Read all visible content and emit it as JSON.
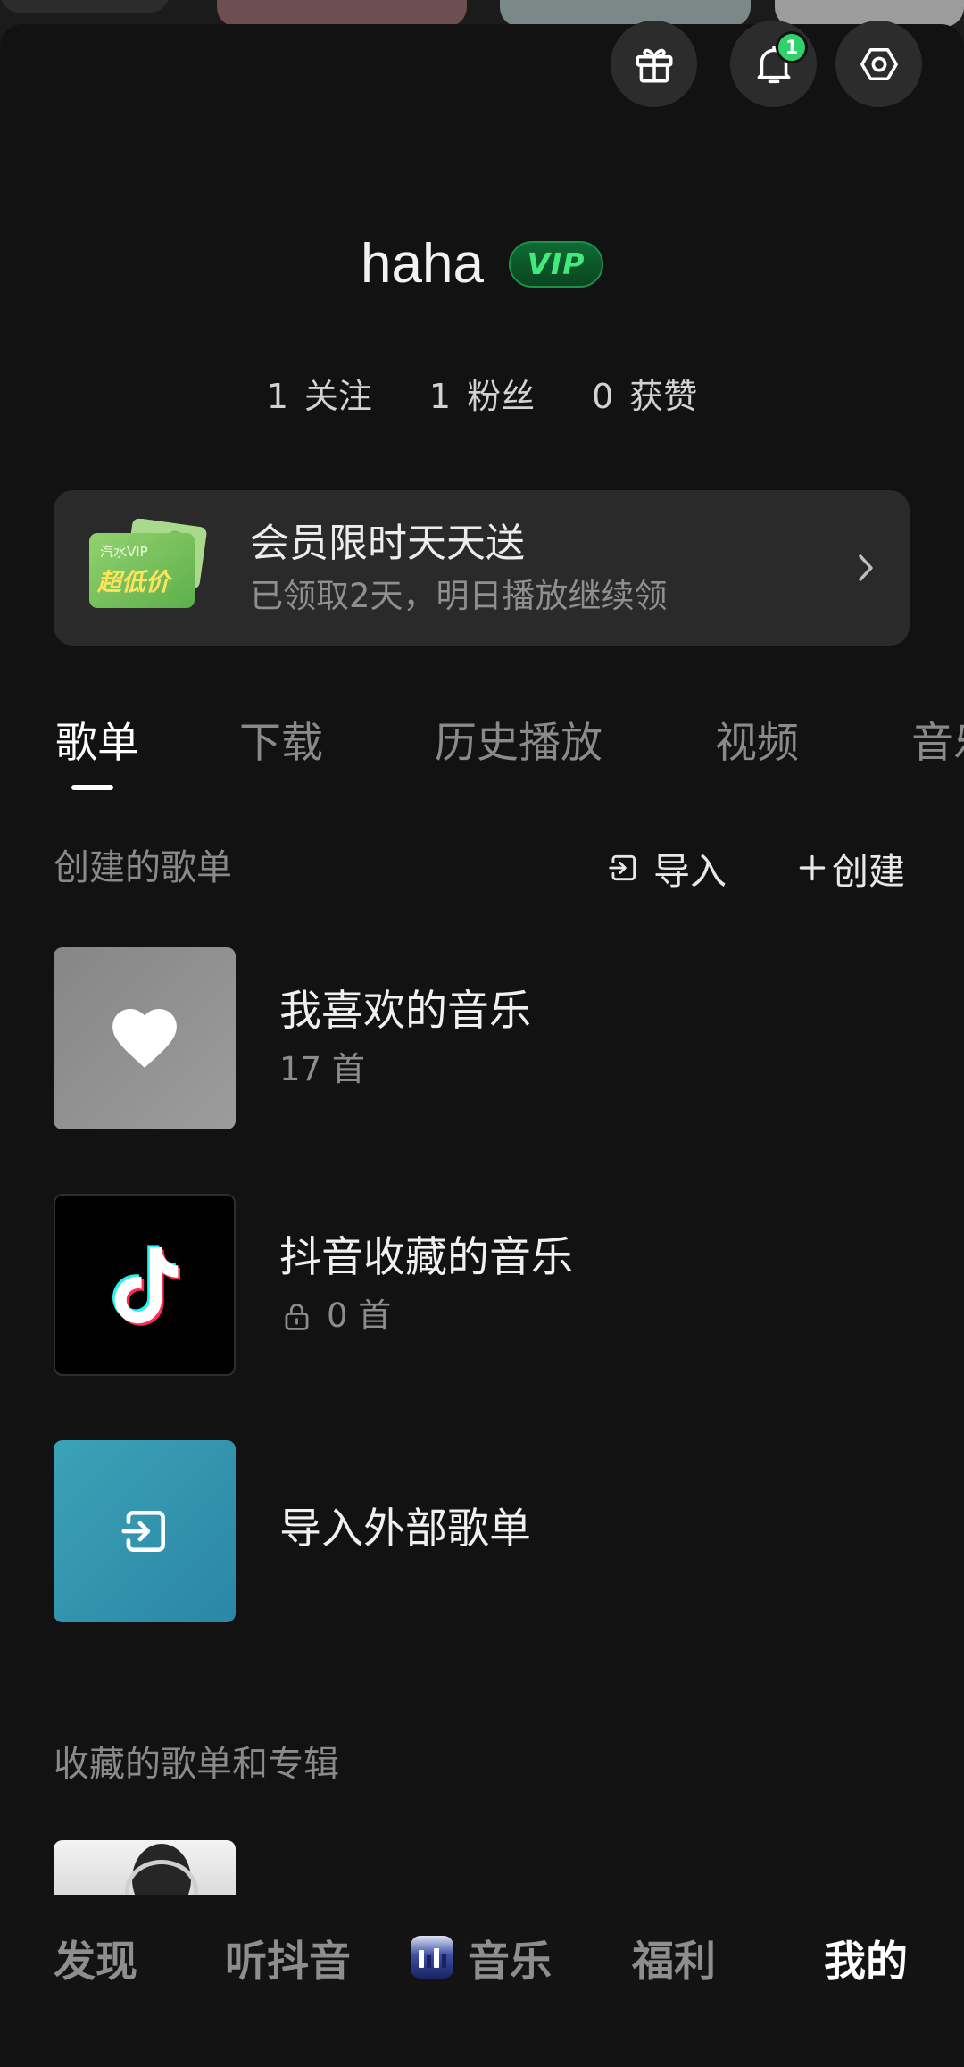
{
  "header": {
    "gift_icon": "gift-icon",
    "notification_icon": "bell-icon",
    "notification_count": "1",
    "settings_icon": "settings-icon"
  },
  "profile": {
    "username": "haha",
    "vip_badge": "VIP",
    "stats": [
      {
        "count": "1",
        "label": "关注"
      },
      {
        "count": "1",
        "label": "粉丝"
      },
      {
        "count": "0",
        "label": "获赞"
      }
    ]
  },
  "promo": {
    "ticket_brand": "汽水VIP",
    "ticket_text": "超低价",
    "title": "会员限时天天送",
    "subtitle": "已领取2天，明日播放继续领",
    "arrow_icon": "chevron-right-icon"
  },
  "tabs": [
    {
      "label": "歌单",
      "active": true
    },
    {
      "label": "下载",
      "active": false
    },
    {
      "label": "历史播放",
      "active": false
    },
    {
      "label": "视频",
      "active": false
    },
    {
      "label": "音乐",
      "active": false
    }
  ],
  "created_playlists": {
    "title": "创建的歌单",
    "import_label": "导入",
    "import_icon": "import-icon",
    "create_label": "创建",
    "create_icon": "plus-icon",
    "items": [
      {
        "title": "我喜欢的音乐",
        "count": "17 首",
        "cover_icon": "heart-icon",
        "locked": false
      },
      {
        "title": "抖音收藏的音乐",
        "count": "0 首",
        "cover_icon": "tiktok-logo-icon",
        "locked": true
      },
      {
        "title": "导入外部歌单",
        "cover_icon": "import-icon"
      }
    ]
  },
  "collected_playlists": {
    "title": "收藏的歌单和专辑"
  },
  "bottom_nav": [
    {
      "label": "发现",
      "active": false
    },
    {
      "label": "听抖音",
      "active": false
    },
    {
      "label": "音乐",
      "icon": "music-app-icon",
      "active": false
    },
    {
      "label": "福利",
      "active": false
    },
    {
      "label": "我的",
      "active": true
    }
  ],
  "colors": {
    "background": "#121212",
    "card": "#2a2a2a",
    "accent_green": "#2fd16a",
    "vip_green": "#43e97b",
    "import_cover": "#2b86a7"
  }
}
